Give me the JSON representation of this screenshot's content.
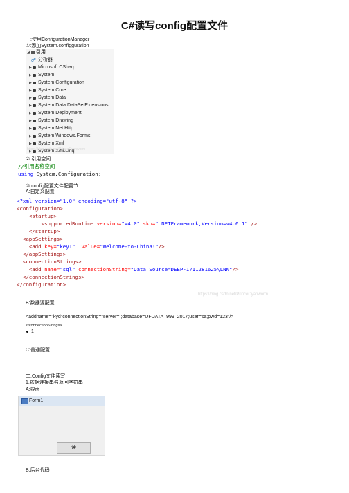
{
  "title": "C#读写config配置文件",
  "section1": {
    "heading": "一:使用ConfigurationManager",
    "step1": "①:添加System.configguration",
    "tree": {
      "root_label": "引用",
      "items": [
        {
          "label": "分析器",
          "icon": "analyzer-icon"
        },
        {
          "label": "Microsoft.CSharp",
          "icon": "reference-icon"
        },
        {
          "label": "System",
          "icon": "reference-icon"
        },
        {
          "label": "System.Configuration",
          "icon": "reference-icon"
        },
        {
          "label": "System.Core",
          "icon": "reference-icon"
        },
        {
          "label": "System.Data",
          "icon": "reference-icon"
        },
        {
          "label": "System.Data.DataSetExtensions",
          "icon": "reference-icon"
        },
        {
          "label": "System.Deployment",
          "icon": "reference-icon"
        },
        {
          "label": "System.Drawing",
          "icon": "reference-icon"
        },
        {
          "label": "System.Net.Http",
          "icon": "reference-icon"
        },
        {
          "label": "System.Windows.Forms",
          "icon": "reference-icon"
        },
        {
          "label": "System.Xml",
          "icon": "reference-icon"
        },
        {
          "label": "System.Xml.Linq",
          "icon": "reference-icon"
        }
      ],
      "watermark": "https://blog.csdn.net/PrinceCyanworm"
    },
    "step2": "②:引用空间",
    "code_using": {
      "comment": "//引用名称空间",
      "kw": "using",
      "ns": " System.Configuration;"
    },
    "step3": "③:config配置文件配置节",
    "sub_a": "A:自定义配置",
    "xml": {
      "line1": "<?xml version=\"1.0\" encoding=\"utf-8\" ?>",
      "line2": "<configuration>",
      "line3": "<startup>",
      "line4_tag": "<supportedRuntime",
      "line4_a1": " version=",
      "line4_v1": "\"v4.0\"",
      "line4_a2": " sku=",
      "line4_v2": "\".NETFramework,Version=v4.6.1\"",
      "line4_end": " />",
      "line5": "</startup>",
      "line6": "<appSettings>",
      "line7_tag": "<add",
      "line7_a1": " key=",
      "line7_v1": "\"key1\"",
      "line7_a2": "  value=",
      "line7_v2": "\"Welcome-to-China!\"",
      "line7_end": "/>",
      "line8": "</appSettings>",
      "line9": "<connectionStrings>",
      "line10_tag": "<add",
      "line10_a1": " name=",
      "line10_v1": "\"sql\"",
      "line10_a2": " connectionString=",
      "line10_v2": "\"Data Source=DEEP-1711281625\\LNN\"",
      "line10_end": "/>",
      "line11": "</connectionStrings>",
      "line12": "</configuration>",
      "watermark": "https://blog.csdn.net/PrinceCyanworm"
    },
    "sub_b": "B:数据源配置",
    "b_line1": "<addname=\"kyd\"connectionString=\"server=.;database=UFDATA_999_2017;user=sa;pwd=123\"/>",
    "b_line2": "</connectionStrings>",
    "bullet_text": "1",
    "sub_c": "C:普通配置"
  },
  "section2": {
    "heading": "二:Config文件读写",
    "step1": "1.依据连接串名返回字符串",
    "sub_a": "A:界面",
    "form": {
      "title": "Form1",
      "button_label": "读"
    },
    "sub_b": "B:后台代码"
  }
}
